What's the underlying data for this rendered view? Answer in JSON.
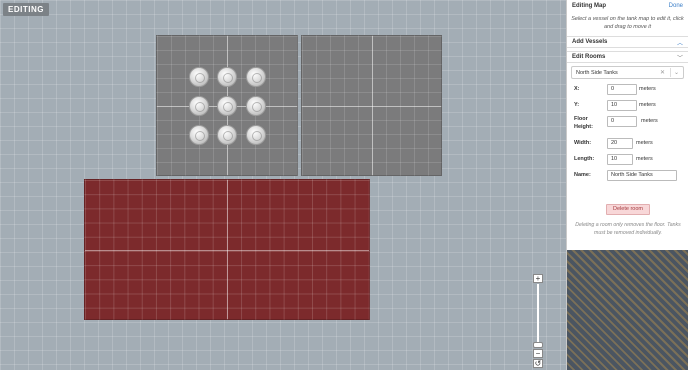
{
  "mode_badge": "EDITING",
  "panel": {
    "title": "Editing Map",
    "done_label": "Done",
    "hint": "Select a vessel on the tank map to edit it, click and drag to move it",
    "add_vessels": {
      "label": "Add Vessels",
      "icon": "chevron-up-icon"
    },
    "edit_rooms": {
      "label": "Edit Rooms",
      "icon": "chevron-down-icon"
    },
    "room_select": {
      "value": "North Side Tanks",
      "clear_icon": "✕",
      "dropdown_icon": "⌄"
    },
    "fields": {
      "x": {
        "label": "X:",
        "value": "0",
        "unit": "meters"
      },
      "y": {
        "label": "Y:",
        "value": "10",
        "unit": "meters"
      },
      "floor_height": {
        "label_line1": "Floor",
        "label_line2": "Height:",
        "value": "0",
        "unit": "meters"
      },
      "width": {
        "label": "Width:",
        "value": "20",
        "unit": "meters"
      },
      "length": {
        "label": "Length:",
        "value": "10",
        "unit": "meters"
      },
      "name": {
        "label": "Name:",
        "value": "North Side Tanks"
      }
    },
    "delete_button": "Delete room",
    "delete_note": "Deleting a room only removes the floor. Tanks must be removed individually."
  },
  "zoom": {
    "in_label": "+",
    "out_label": "−",
    "reset_label": "↺"
  },
  "colors": {
    "accent": "#3c7fc8",
    "room_selected": "#7c2a2c",
    "room": "#7b7b7c",
    "delete_bg": "#f8d7d8"
  }
}
